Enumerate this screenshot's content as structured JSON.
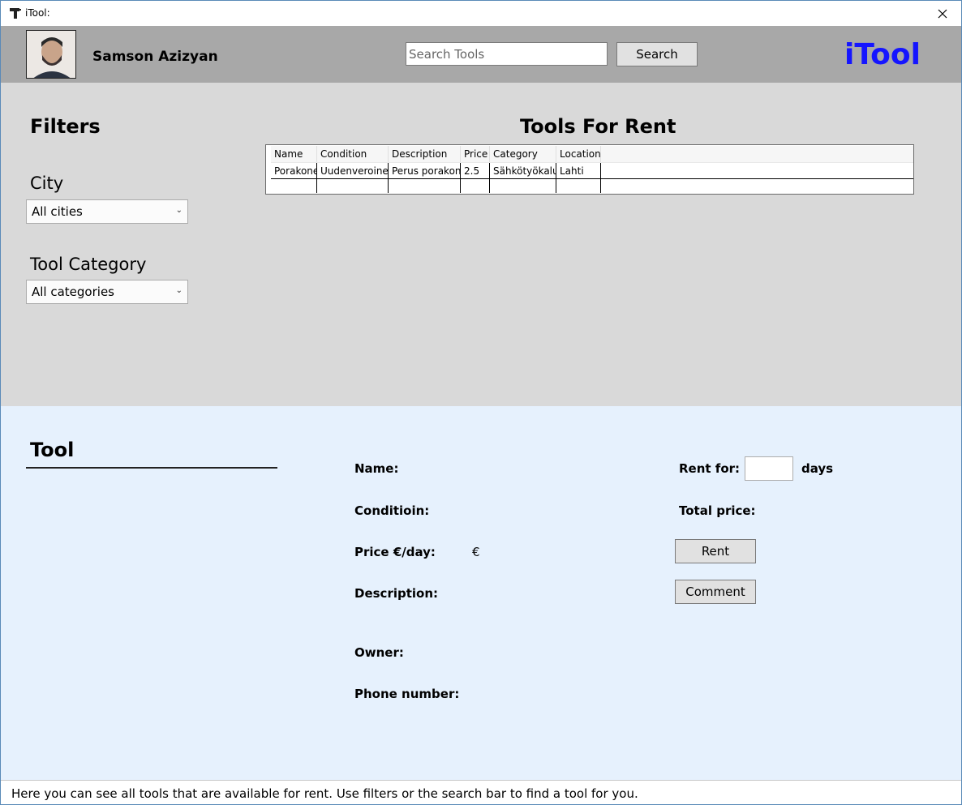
{
  "window": {
    "title": "iTool:"
  },
  "header": {
    "user_name": "Samson Azizyan",
    "search_placeholder": "Search Tools",
    "search_label": "Search",
    "logo": "iTool"
  },
  "filters": {
    "title": "Filters",
    "city_label": "City",
    "city_selected": "All cities",
    "category_label": "Tool Category",
    "category_selected": "All categories"
  },
  "tools_table": {
    "title": "Tools For Rent",
    "columns": [
      "Name",
      "Condition",
      "Description",
      "Price",
      "Category",
      "Location"
    ],
    "rows": [
      [
        "Porakone",
        "Uudenveroinen",
        "Perus porakone",
        "2.5",
        "Sähkötyökalut",
        "Lahti"
      ]
    ]
  },
  "tool_details": {
    "title": "Tool",
    "name_label": "Name:",
    "condition_label": "Conditioin:",
    "price_label": "Price €/day:",
    "price_currency": "€",
    "description_label": "Description:",
    "owner_label": "Owner:",
    "phone_label": "Phone number:",
    "rent_for_label": "Rent for:",
    "days_label": "days",
    "total_price_label": "Total price:",
    "rent_button": "Rent",
    "comment_button": "Comment"
  },
  "status_bar": {
    "text": "Here you can see all tools that are available for rent. Use filters or the search bar to find a tool for you."
  },
  "colors": {
    "header_bg": "#a8a8a8",
    "upper_bg": "#d9d9d9",
    "lower_bg": "#e6f1fd",
    "logo": "#1515ff"
  }
}
